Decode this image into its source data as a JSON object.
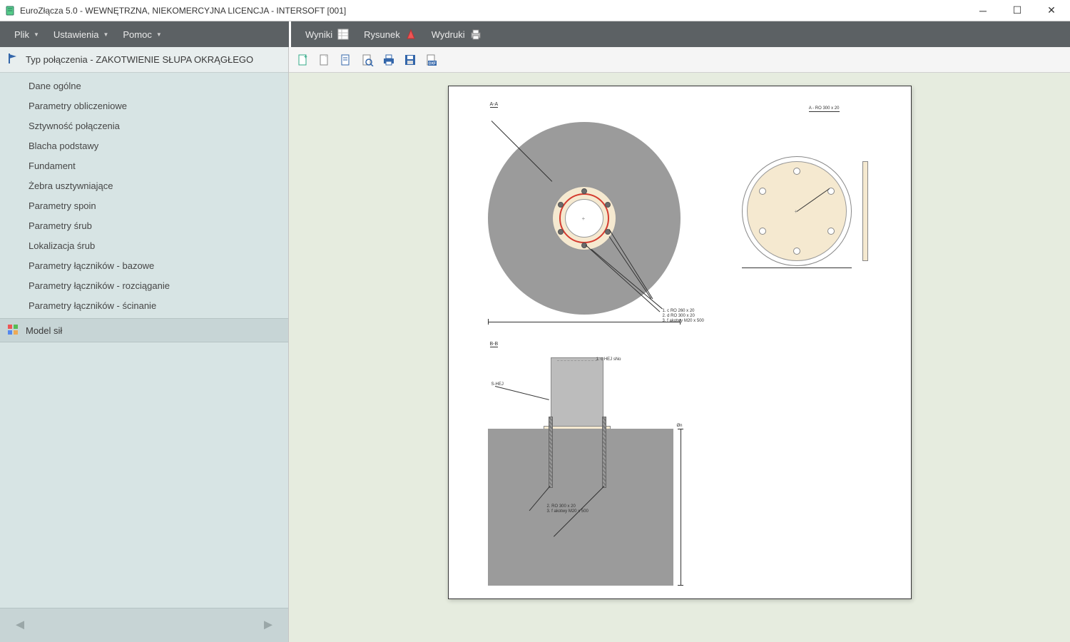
{
  "window": {
    "title": "EuroZłącza 5.0 - WEWNĘTRZNA, NIEKOMERCYJNA LICENCJA - INTERSOFT [001]"
  },
  "menus": {
    "left": [
      {
        "label": "Plik"
      },
      {
        "label": "Ustawienia"
      },
      {
        "label": "Pomoc"
      }
    ],
    "right": [
      {
        "label": "Wyniki"
      },
      {
        "label": "Rysunek"
      },
      {
        "label": "Wydruki"
      }
    ]
  },
  "toolbar_icons": {
    "new": "new-page-icon",
    "doc": "document-icon",
    "page": "page-icon",
    "preview": "preview-icon",
    "print": "print-icon",
    "save": "save-icon",
    "dxf": "dxf-export-icon"
  },
  "sidebar": {
    "header": "Typ połączenia - ZAKOTWIENIE SŁUPA OKRĄGŁEGO",
    "items": [
      {
        "label": "Dane ogólne"
      },
      {
        "label": "Parametry obliczeniowe"
      },
      {
        "label": "Sztywność połączenia"
      },
      {
        "label": "Blacha podstawy"
      },
      {
        "label": "Fundament"
      },
      {
        "label": "Żebra usztywniające"
      },
      {
        "label": "Parametry spoin"
      },
      {
        "label": "Parametry śrub"
      },
      {
        "label": "Lokalizacja śrub"
      },
      {
        "label": "Parametry łączników - bazowe"
      },
      {
        "label": "Parametry łączników - rozciąganie"
      },
      {
        "label": "Parametry łączników - ścinanie"
      }
    ],
    "section": "Model sił"
  },
  "drawing": {
    "labels": {
      "view_top": "A-A",
      "view_side": "B-B",
      "plate_detail": "A - RO 300 x 20"
    },
    "bolt_count": 6
  }
}
